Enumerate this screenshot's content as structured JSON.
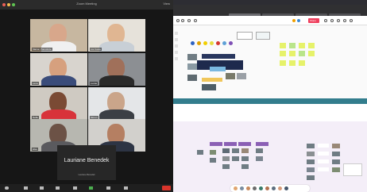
{
  "zoom": {
    "window_title": "Zoom Meeting",
    "view_label": "View",
    "colors": {
      "background": "#161616",
      "end_button": "#d9342b",
      "traffic_red": "#ec5f56",
      "traffic_yellow": "#f5bd4f",
      "traffic_green": "#5fc452"
    },
    "participants": [
      {
        "name": "Marion Pianoforte",
        "badge": ""
      },
      {
        "name": "Lia Costa",
        "badge": ""
      },
      {
        "name": "Lena",
        "badge": ""
      },
      {
        "name": "Lucas",
        "badge": ""
      },
      {
        "name": "Nella",
        "badge": ""
      },
      {
        "name": "Simon",
        "badge": ""
      },
      {
        "name": "Elsa",
        "badge": ""
      },
      {
        "name": "Sebastien",
        "badge": ""
      }
    ],
    "speaker": {
      "name": "Lauriane Benedek",
      "subtitle": "Lauriane Benedek"
    },
    "toolbar_icons": [
      "microphone-icon",
      "video-icon",
      "security-icon",
      "participants-icon",
      "chat-icon",
      "share-screen-icon",
      "record-icon",
      "reactions-icon"
    ]
  },
  "board": {
    "app": "Miro",
    "mac_title": "",
    "share_label": "Share",
    "zoom_level": "",
    "colors": {
      "divider": "#337d8d",
      "lower_bg": "#f4eef8",
      "share": "#ef3e5c",
      "sticky": "#e9f36b",
      "tag": "#8b5fb5"
    },
    "section_top_left": "",
    "section_top_right": "",
    "section_lower": ""
  }
}
